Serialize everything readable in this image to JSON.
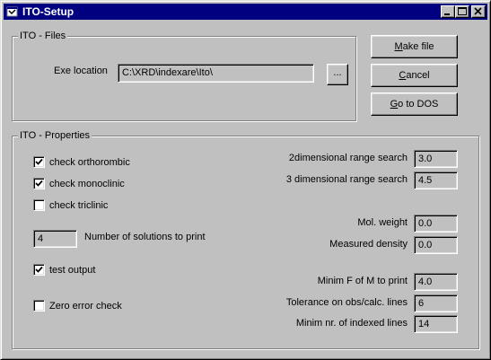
{
  "window": {
    "title": "ITO-Setup",
    "title_icon": "app-icon",
    "controls": [
      "minimize-icon",
      "maximize-icon",
      "close-icon"
    ]
  },
  "files_group": {
    "label": "ITO - Files",
    "exe_location_label": "Exe location",
    "exe_location_value": "C:\\XRD\\indexare\\Ito\\",
    "browse_label": "..."
  },
  "buttons": {
    "make_file_prefix": "",
    "make_file_ul": "M",
    "make_file_rest": "ake file",
    "cancel_prefix": "",
    "cancel_ul": "C",
    "cancel_rest": "ancel",
    "goto_prefix": "",
    "goto_ul": "G",
    "goto_rest": "o to DOS"
  },
  "properties_group": {
    "label": "ITO - Properties",
    "check_orthorombic": {
      "label": "check orthorombic",
      "checked": true
    },
    "check_monoclinic": {
      "label": "check monoclinic",
      "checked": true
    },
    "check_triclinic": {
      "label": "check triclinic",
      "checked": false
    },
    "num_solutions_value": "4",
    "num_solutions_label": "Number of solutions to print",
    "test_output": {
      "label": "test output",
      "checked": true
    },
    "zero_error": {
      "label": "Zero error check",
      "checked": false
    },
    "range2d_label": "2dimensional range search",
    "range2d_value": "3.0",
    "range3d_label": "3 dimensional range search",
    "range3d_value": "4.5",
    "mol_weight_label": "Mol. weight",
    "mol_weight_value": "0.0",
    "density_label": "Measured density",
    "density_value": "0.0",
    "min_fom_label": "Minim F of M to print",
    "min_fom_value": "4.0",
    "tolerance_label": "Tolerance on obs/calc. lines",
    "tolerance_value": "6",
    "min_lines_label": "Minim nr. of indexed lines",
    "min_lines_value": "14"
  }
}
